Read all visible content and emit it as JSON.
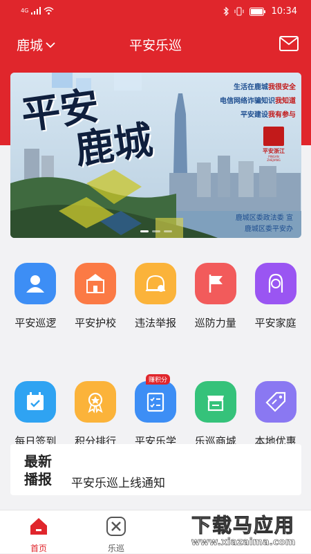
{
  "status": {
    "network": "4G",
    "time": "10:34"
  },
  "header": {
    "location": "鹿城",
    "title": "平安乐巡"
  },
  "banner": {
    "title_line1": "平安",
    "title_line2": "鹿城",
    "lines": [
      "生活在鹿城",
      "我很安全",
      "电信网络诈骗知识",
      "我知道",
      "平安建设",
      "我有参与"
    ],
    "seal_text": "平安浙江",
    "seal_sub": "PINGAN ZHEJIANG",
    "footer1": "鹿城区委政法委",
    "footer2": "鹿城区委平安办",
    "footer_mark": "宣"
  },
  "grid": {
    "row1": [
      {
        "label": "平安巡逻",
        "icon": "patrol-user-icon",
        "color": "#3d8ef5"
      },
      {
        "label": "平安护校",
        "icon": "school-icon",
        "color": "#fb7a45"
      },
      {
        "label": "违法举报",
        "icon": "report-helmet-icon",
        "color": "#fbb33a"
      },
      {
        "label": "巡防力量",
        "icon": "flag-icon",
        "color": "#f25b5b"
      },
      {
        "label": "平安家庭",
        "icon": "family-icon",
        "color": "#9a55f2"
      }
    ],
    "row2": [
      {
        "label": "每日签到",
        "icon": "calendar-check-icon",
        "color": "#2fa3f2"
      },
      {
        "label": "积分排行",
        "icon": "medal-icon",
        "color": "#fbb33a"
      },
      {
        "label": "平安乐学",
        "icon": "study-list-icon",
        "color": "#3d8ef5",
        "badge": "赚积分"
      },
      {
        "label": "乐巡商城",
        "icon": "shop-icon",
        "color": "#35c27a"
      },
      {
        "label": "本地优惠",
        "icon": "tag-icon",
        "color": "#8a78f2"
      }
    ]
  },
  "news": {
    "tag1": "最新",
    "tag2": "播报",
    "text": "平安乐巡上线通知"
  },
  "tabs": [
    {
      "label": "首页",
      "icon": "home-icon",
      "active": true
    },
    {
      "label": "乐巡",
      "icon": "patrol-tools-icon",
      "active": false
    }
  ],
  "watermark": {
    "main": "下载马应用",
    "sub": "www.xiazaima.com"
  },
  "colors": {
    "brand_red": "#e0262c",
    "background": "#f2f2f4"
  }
}
